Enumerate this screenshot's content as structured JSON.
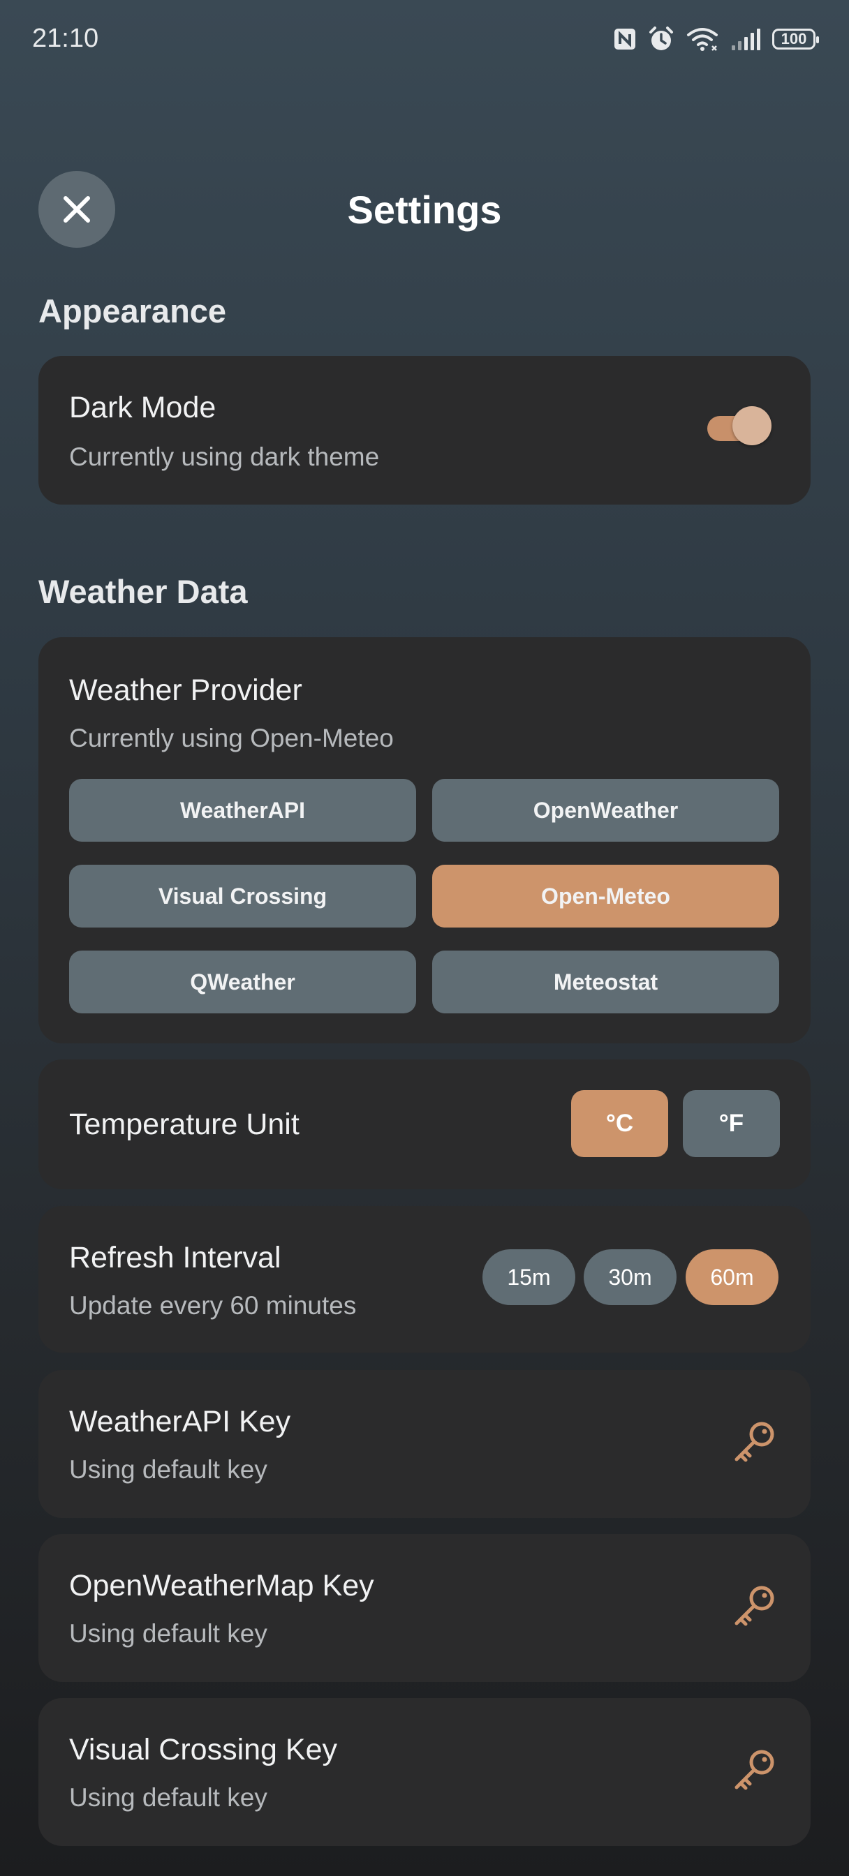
{
  "status": {
    "time": "21:10",
    "battery": "100",
    "icons": [
      "nfc-icon",
      "alarm-icon",
      "wifi-icon",
      "signal-icon",
      "battery-icon"
    ]
  },
  "header": {
    "title": "Settings",
    "close_icon": "close-icon"
  },
  "appearance": {
    "section_title": "Appearance",
    "dark_mode": {
      "title": "Dark Mode",
      "subtitle": "Currently using dark theme",
      "enabled": true
    }
  },
  "weather_data": {
    "section_title": "Weather Data",
    "provider": {
      "title": "Weather Provider",
      "subtitle": "Currently using Open-Meteo",
      "options": [
        "WeatherAPI",
        "OpenWeather",
        "Visual Crossing",
        "Open-Meteo",
        "QWeather",
        "Meteostat"
      ],
      "selected": "Open-Meteo"
    },
    "temperature_unit": {
      "title": "Temperature Unit",
      "options": [
        "°C",
        "°F"
      ],
      "selected": "°C"
    },
    "refresh_interval": {
      "title": "Refresh Interval",
      "subtitle": "Update every 60 minutes",
      "options": [
        "15m",
        "30m",
        "60m"
      ],
      "selected": "60m"
    },
    "api_keys": [
      {
        "title": "WeatherAPI Key",
        "subtitle": "Using default key",
        "icon": "key-icon"
      },
      {
        "title": "OpenWeatherMap Key",
        "subtitle": "Using default key",
        "icon": "key-icon"
      },
      {
        "title": "Visual Crossing Key",
        "subtitle": "Using default key",
        "icon": "key-icon"
      }
    ]
  },
  "colors": {
    "accent": "#cd946b",
    "button_inactive": "#606d74",
    "card_bg": "#2b2b2c"
  }
}
